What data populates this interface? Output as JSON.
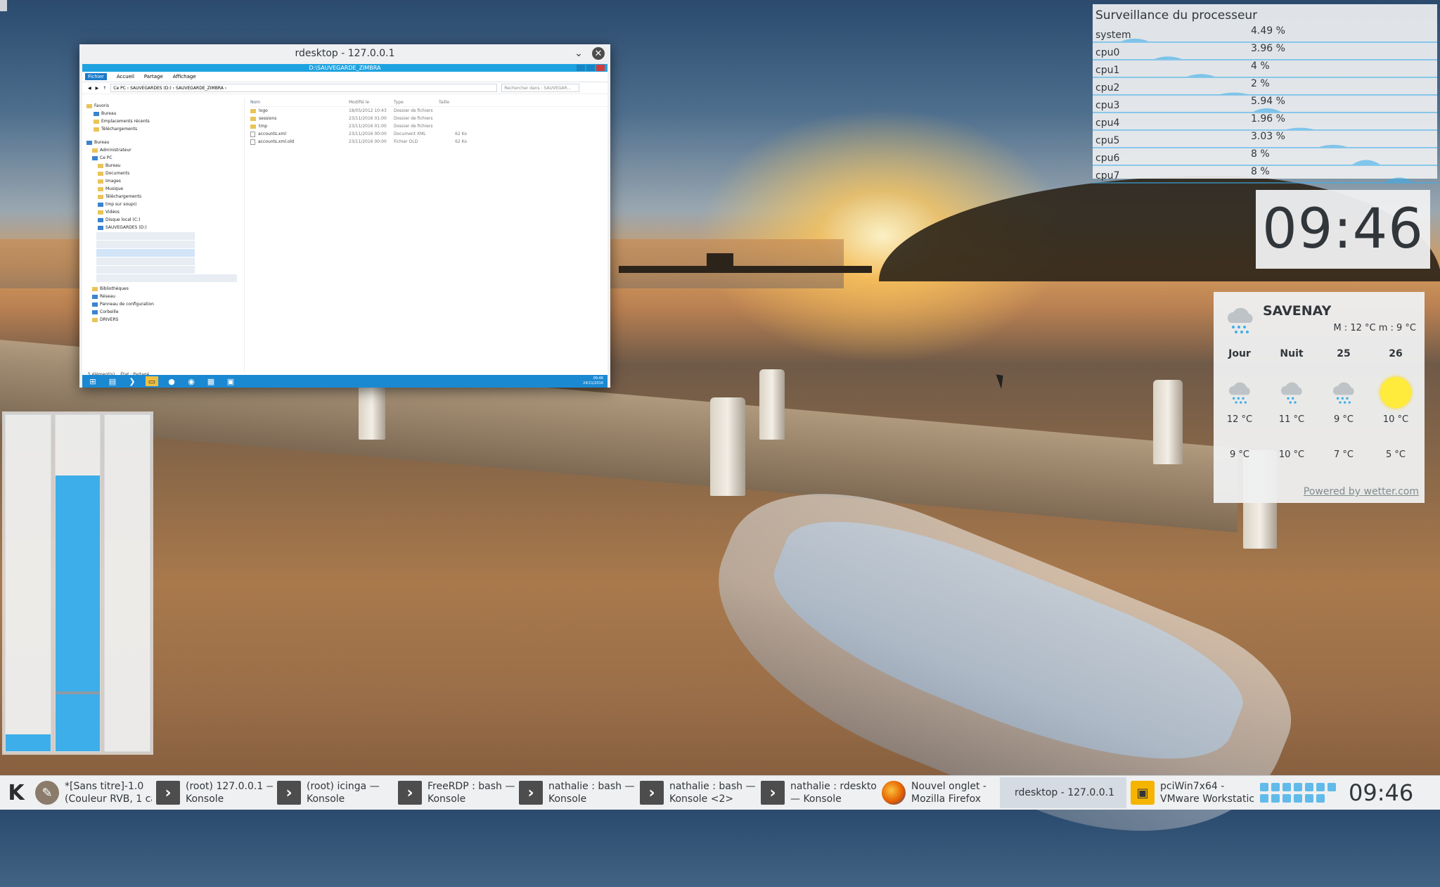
{
  "rdesktop": {
    "title": "rdesktop - 127.0.0.1",
    "explorer": {
      "window_title": "D:\\SAUVEGARDE_ZIMBRA",
      "ribbon_tabs": [
        "Fichier",
        "Accueil",
        "Partage",
        "Affichage"
      ],
      "address": "Ce PC  ›  SAUVEGARDES (D:)  ›  SAUVEGARDE_ZIMBRA  ›",
      "search_placeholder": "Rechercher dans : SAUVEGAR...",
      "tree": [
        "Favoris",
        "Bureau",
        "Emplacements récents",
        "Téléchargements",
        "Bureau",
        "Administrateur",
        "Ce PC",
        "Bureau",
        "Documents",
        "Images",
        "Musique",
        "Téléchargements",
        "tmp sur soupci",
        "Vidéos",
        "Disque local (C:)",
        "SAUVEGARDES (D:)",
        "Bibliothèques",
        "Réseau",
        "Panneau de configuration",
        "Corbeille",
        "DRIVERS"
      ],
      "columns": [
        "Nom",
        "Modifié le",
        "Type",
        "Taille"
      ],
      "files": [
        {
          "name": "logo",
          "date": "18/05/2012 10:43",
          "type": "Dossier de fichiers",
          "size": ""
        },
        {
          "name": "sessions",
          "date": "23/11/2016 01:00",
          "type": "Dossier de fichiers",
          "size": ""
        },
        {
          "name": "tmp",
          "date": "23/11/2016 01:00",
          "type": "Dossier de fichiers",
          "size": ""
        },
        {
          "name": "accounts.xml",
          "date": "23/11/2016 00:00",
          "type": "Document XML",
          "size": "62 Ko"
        },
        {
          "name": "accounts.xml.old",
          "date": "23/11/2016 00:00",
          "type": "Fichier OLD",
          "size": "62 Ko"
        }
      ],
      "status_count": "5 élément(s)",
      "status_state": "État : Partagé",
      "clock_time": "09:46",
      "clock_date": "24/11/2016"
    }
  },
  "cpu_monitor": {
    "title": "Surveillance du processeur",
    "rows": [
      {
        "label": "system",
        "value": "4.49 %",
        "percent": 4.49
      },
      {
        "label": "cpu0",
        "value": "3.96 %",
        "percent": 3.96
      },
      {
        "label": "cpu1",
        "value": "4 %",
        "percent": 4
      },
      {
        "label": "cpu2",
        "value": "2 %",
        "percent": 2
      },
      {
        "label": "cpu3",
        "value": "5.94 %",
        "percent": 5.94
      },
      {
        "label": "cpu4",
        "value": "1.96 %",
        "percent": 1.96
      },
      {
        "label": "cpu5",
        "value": "3.03 %",
        "percent": 3.03
      },
      {
        "label": "cpu6",
        "value": "8 %",
        "percent": 8
      },
      {
        "label": "cpu7",
        "value": "8 %",
        "percent": 8
      }
    ],
    "graph_color": "#3daee9"
  },
  "clock": {
    "time": "09:46"
  },
  "weather": {
    "city": "SAVENAY",
    "minmax": "M : 12 °C m : 9 °C",
    "days": [
      {
        "label": "Jour",
        "icon": "snow-cloud-icon",
        "high": "12 °C",
        "low": "9 °C"
      },
      {
        "label": "Nuit",
        "icon": "snow-cloud-icon",
        "high": "11 °C",
        "low": "10 °C"
      },
      {
        "label": "25",
        "icon": "snow-cloud-icon",
        "high": "9 °C",
        "low": "7 °C"
      },
      {
        "label": "26",
        "icon": "sun-icon",
        "high": "10 °C",
        "low": "5 °C"
      }
    ],
    "powered": "Powered by wetter.com"
  },
  "bars": {
    "levels": [
      0.05,
      0.82,
      0.0
    ],
    "marker": 0.17,
    "color": "#3daee9"
  },
  "taskbar": {
    "tasks": [
      {
        "icon": "gimp-icon",
        "line1": "*[Sans titre]-1.0",
        "line2": "(Couleur RVB, 1 calc"
      },
      {
        "icon": "konsole-icon",
        "line1": "(root) 127.0.0.1 —",
        "line2": "Konsole"
      },
      {
        "icon": "konsole-icon",
        "line1": "(root) icinga —",
        "line2": "Konsole"
      },
      {
        "icon": "konsole-icon",
        "line1": "FreeRDP : bash —",
        "line2": "Konsole"
      },
      {
        "icon": "konsole-icon",
        "line1": "nathalie : bash —",
        "line2": "Konsole"
      },
      {
        "icon": "konsole-icon",
        "line1": "nathalie : bash —",
        "line2": "Konsole <2>"
      },
      {
        "icon": "konsole-icon",
        "line1": "nathalie : rdesktop",
        "line2": "— Konsole"
      },
      {
        "icon": "firefox-icon",
        "line1": "Nouvel onglet -",
        "line2": "Mozilla Firefox"
      }
    ],
    "active_task": "rdesktop - 127.0.0.1",
    "vmware_task": {
      "line1": "pciWin7x64 -",
      "line2": "VMware Workstatic"
    },
    "clock": "09:46"
  }
}
